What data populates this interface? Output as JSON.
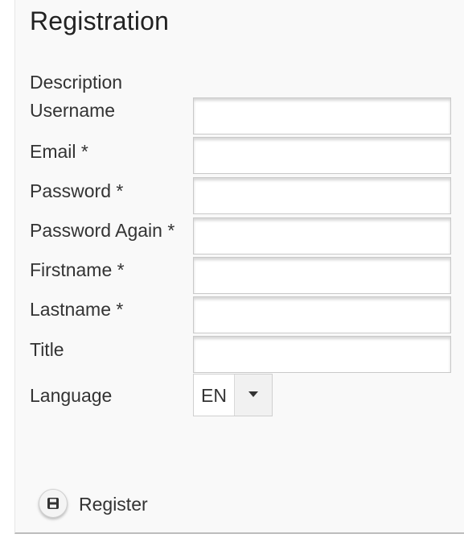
{
  "form": {
    "title": "Registration",
    "description_label": "Description",
    "fields": [
      {
        "label": "Username",
        "value": ""
      },
      {
        "label": "Email  *",
        "value": ""
      },
      {
        "label": "Password  *",
        "value": ""
      },
      {
        "label": "Password Again  *",
        "value": ""
      },
      {
        "label": "Firstname  *",
        "value": ""
      },
      {
        "label": "Lastname  *",
        "value": ""
      },
      {
        "label": "Title",
        "value": ""
      }
    ],
    "language": {
      "label": "Language",
      "selected": "EN"
    },
    "register_label": "Register",
    "register_icon": "save-icon"
  },
  "colors": {
    "text": "#333333",
    "panel_bg": "#f9f9f9",
    "field_border": "#c9c9c9"
  }
}
